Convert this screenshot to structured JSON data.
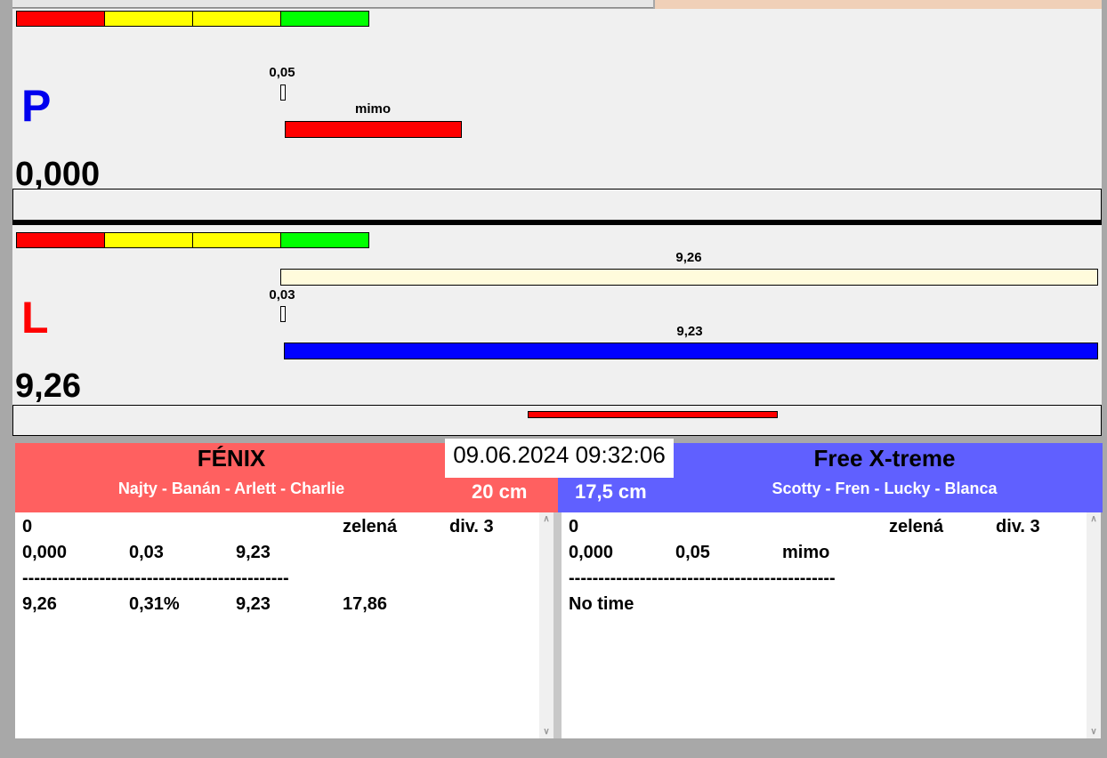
{
  "scale_colors": [
    "#ff0000",
    "#ffff00",
    "#ffff00",
    "#00ff00"
  ],
  "top": {
    "letter": "P",
    "letter_color": "#0000ee",
    "value": "0,000",
    "marker_label": "0,05",
    "bar_label": "mimo",
    "bar_color": "#ff0000"
  },
  "bottom": {
    "letter": "L",
    "letter_color": "#ff0000",
    "value": "9,26",
    "marker_label": "0,03",
    "bar1_label": "9,26",
    "bar1_color": "#fffbdc",
    "bar2_label": "9,23",
    "bar2_color": "#0000ff",
    "indicator_color": "#ff0000"
  },
  "datetime": "09.06.2024 09:32:06",
  "left_team": {
    "name": "FÉNIX",
    "members": "Najty - Banán - Arlett - Charlie",
    "distance": "20 cm",
    "color": "#ff6060",
    "rows": [
      [
        "0",
        "",
        "",
        "zelená",
        "div. 3"
      ],
      [
        "0,000",
        "0,03",
        "9,23",
        "",
        ""
      ],
      [
        "---------------------------------------------",
        "",
        "",
        "",
        ""
      ],
      [
        "9,26",
        "0,31%",
        "9,23",
        "17,86",
        ""
      ]
    ]
  },
  "right_team": {
    "name": "Free X-treme",
    "members": "Scotty - Fren - Lucky - Blanca",
    "distance": "17,5 cm",
    "color": "#6060ff",
    "rows": [
      [
        "0",
        "",
        "",
        "zelená",
        "div. 3"
      ],
      [
        "0,000",
        "0,05",
        "mimo",
        "",
        ""
      ],
      [
        "---------------------------------------------",
        "",
        "",
        "",
        ""
      ],
      [
        "No time",
        "",
        "",
        "",
        ""
      ]
    ]
  }
}
